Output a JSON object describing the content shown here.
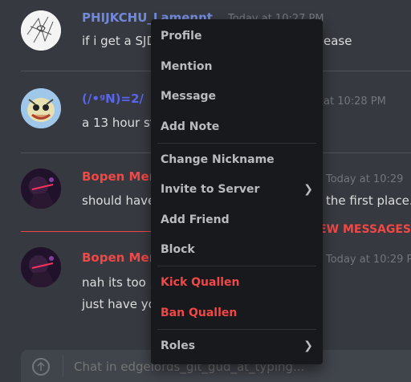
{
  "messages": [
    {
      "author": "PHIJKCHU_Lamennt",
      "time": "Today at 10:27 PM",
      "text": "if i get a SJD",
      "text_tail": "ease",
      "author_color": "#7289da"
    },
    {
      "author": "(/•ᵍN)=2/",
      "time": "at 10:28 PM",
      "text": "a 13 hour st",
      "author_color": "#5865f2"
    },
    {
      "author": "Bopen Men",
      "time": "Today at 10:29",
      "text": "should have",
      "text_tail": "the first place.",
      "author_color": "#f04747"
    },
    {
      "author": "Bopen Men",
      "time": "Today at 10:29 P",
      "text": "nah its too ;",
      "text2": "just have yo",
      "author_color": "#f04747"
    }
  ],
  "new_messages_label": "EW MESSAGES",
  "composer": {
    "placeholder": "Chat in edgelords_git_gud_at_typing..."
  },
  "context_menu": {
    "items": [
      {
        "label": "Profile"
      },
      {
        "label": "Mention"
      },
      {
        "label": "Message"
      },
      {
        "label": "Add Note"
      },
      {
        "label": "Change Nickname"
      },
      {
        "label": "Invite to Server",
        "submenu": true
      },
      {
        "label": "Add Friend"
      },
      {
        "label": "Block"
      },
      {
        "label": "Kick Quallen",
        "danger": true
      },
      {
        "label": "Ban Quallen",
        "danger": true
      },
      {
        "label": "Roles",
        "submenu": true
      }
    ],
    "submenu_icon": "chevron-right-icon"
  },
  "colors": {
    "background": "#36393f",
    "menu_background": "#18191c",
    "danger": "#f04747",
    "muted": "#72767d"
  }
}
